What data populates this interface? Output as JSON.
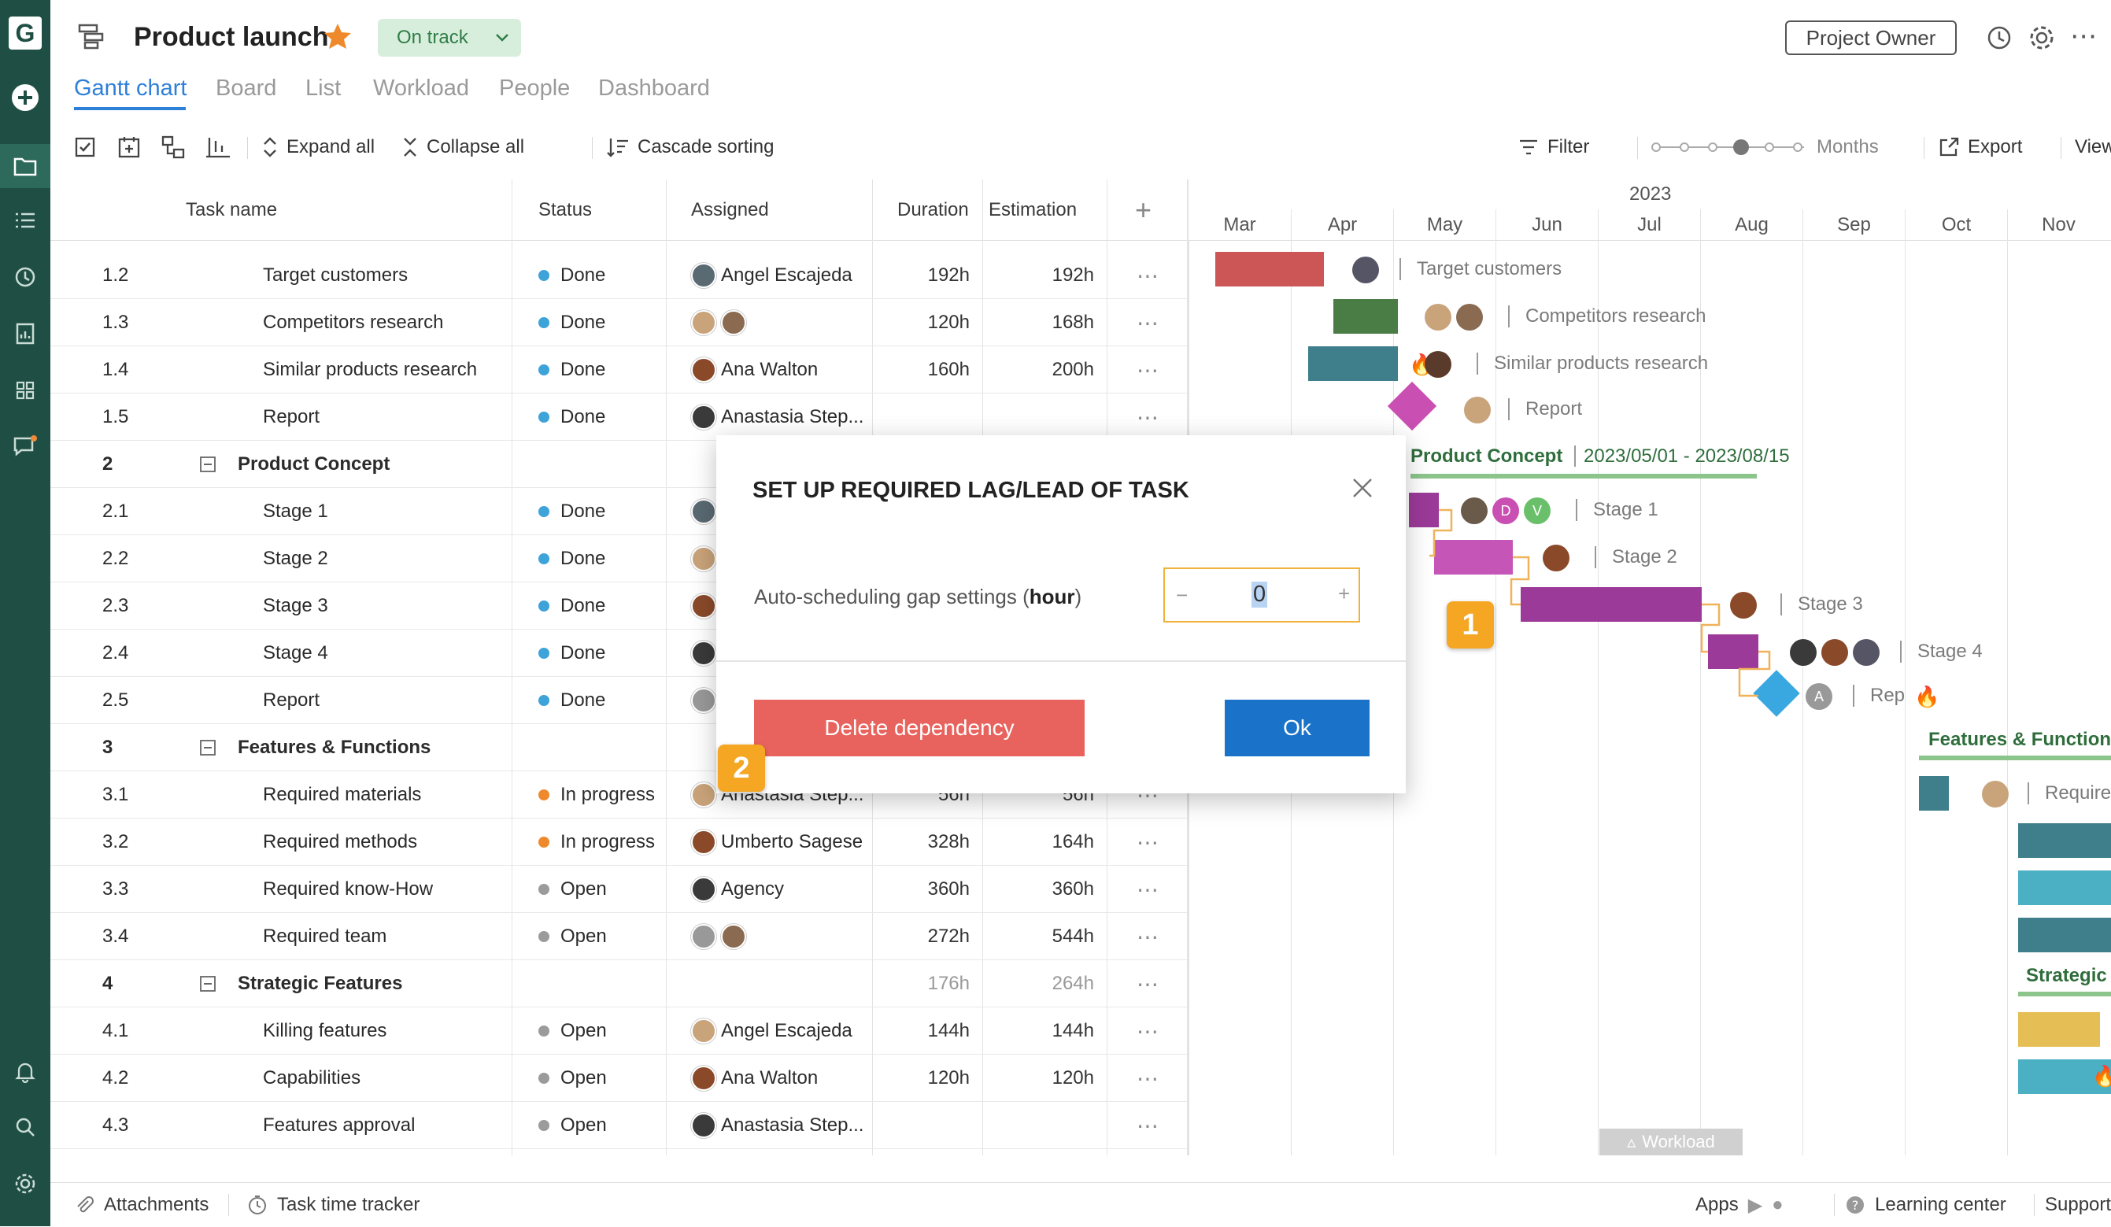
{
  "app": {
    "logo": "G"
  },
  "header": {
    "title": "Product launch",
    "status": "On track",
    "project_owner": "Project Owner",
    "tabs": [
      "Gantt chart",
      "Board",
      "List",
      "Workload",
      "People",
      "Dashboard"
    ],
    "active_tab": "Gantt chart"
  },
  "toolbar": {
    "expand_all": "Expand all",
    "collapse_all": "Collapse all",
    "cascade_sorting": "Cascade sorting",
    "filter": "Filter",
    "zoom_label": "Months",
    "export": "Export",
    "view": "View"
  },
  "grid": {
    "headers": {
      "task": "Task name",
      "status": "Status",
      "assigned": "Assigned",
      "duration": "Duration",
      "estimation": "Estimation"
    },
    "rows": [
      {
        "id": "1.2",
        "name": "Target customers",
        "status": "Done",
        "assignee": "Angel Escajeda",
        "duration": "192h",
        "estimation": "192h"
      },
      {
        "id": "1.3",
        "name": "Competitors research",
        "status": "Done",
        "assignee": "",
        "duration": "120h",
        "estimation": "168h"
      },
      {
        "id": "1.4",
        "name": "Similar products research",
        "status": "Done",
        "assignee": "Ana Walton",
        "duration": "160h",
        "estimation": "200h"
      },
      {
        "id": "1.5",
        "name": "Report",
        "status": "Done",
        "assignee": "Anastasia Step...",
        "duration": "",
        "estimation": ""
      },
      {
        "id": "2",
        "name": "Product Concept",
        "group": true
      },
      {
        "id": "2.1",
        "name": "Stage 1",
        "status": "Done"
      },
      {
        "id": "2.2",
        "name": "Stage 2",
        "status": "Done"
      },
      {
        "id": "2.3",
        "name": "Stage 3",
        "status": "Done"
      },
      {
        "id": "2.4",
        "name": "Stage 4",
        "status": "Done"
      },
      {
        "id": "2.5",
        "name": "Report",
        "status": "Done"
      },
      {
        "id": "3",
        "name": "Features & Functions",
        "group": true
      },
      {
        "id": "3.1",
        "name": "Required materials",
        "status": "In progress",
        "assignee": "Anastasia Step...",
        "duration": "56h",
        "estimation": "56h"
      },
      {
        "id": "3.2",
        "name": "Required methods",
        "status": "In progress",
        "assignee": "Umberto Sagese",
        "duration": "328h",
        "estimation": "164h"
      },
      {
        "id": "3.3",
        "name": "Required know-How",
        "status": "Open",
        "assignee": "Agency",
        "duration": "360h",
        "estimation": "360h"
      },
      {
        "id": "3.4",
        "name": "Required team",
        "status": "Open",
        "assignee": "",
        "duration": "272h",
        "estimation": "544h"
      },
      {
        "id": "4",
        "name": "Strategic Features",
        "group": true,
        "duration": "176h",
        "estimation": "264h"
      },
      {
        "id": "4.1",
        "name": "Killing features",
        "status": "Open",
        "assignee": "Angel Escajeda",
        "duration": "144h",
        "estimation": "144h"
      },
      {
        "id": "4.2",
        "name": "Capabilities",
        "status": "Open",
        "assignee": "Ana Walton",
        "duration": "120h",
        "estimation": "120h"
      },
      {
        "id": "4.3",
        "name": "Features approval",
        "status": "Open",
        "assignee": "Anastasia Step...",
        "duration": "",
        "estimation": ""
      }
    ]
  },
  "gantt": {
    "year": "2023",
    "months": [
      "Mar",
      "Apr",
      "May",
      "Jun",
      "Jul",
      "Aug",
      "Sep",
      "Oct",
      "Nov"
    ],
    "labels": {
      "target": "Target customers",
      "competitors": "Competitors research",
      "similar": "Similar products research",
      "report1": "Report",
      "concept": "Product Concept",
      "concept_dates": "2023/05/01 - 2023/08/15",
      "stage1": "Stage 1",
      "stage2": "Stage 2",
      "stage3": "Stage 3",
      "stage4": "Stage 4",
      "report2": "Rep",
      "features": "Features & Function",
      "required": "Require",
      "strategic": "Strategic",
      "workload": "Workload"
    }
  },
  "dialog": {
    "title": "SET UP REQUIRED LAG/LEAD OF TASK",
    "label_prefix": "Auto-scheduling gap settings (",
    "label_unit": "hour",
    "label_suffix": ")",
    "value": "0",
    "minus": "−",
    "plus": "+",
    "delete_button": "Delete dependency",
    "ok_button": "Ok"
  },
  "markers": {
    "one": "1",
    "two": "2"
  },
  "footer": {
    "attachments": "Attachments",
    "time_tracker": "Task time tracker",
    "apps": "Apps",
    "learning_center": "Learning center",
    "support": "Support"
  },
  "colors": {
    "accent": "#2e7fd8",
    "brand_dark": "#1f4f44",
    "done": "#3da3d9",
    "in_progress": "#ef8a2c",
    "open": "#9b9b9b",
    "delete": "#e8635d",
    "ok": "#1a73c8",
    "marker": "#f5a623"
  }
}
